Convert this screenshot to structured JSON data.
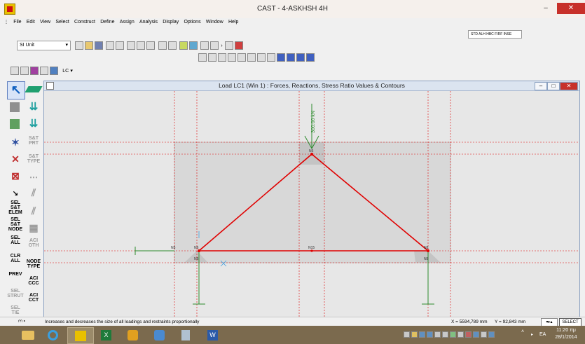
{
  "window": {
    "title": "CAST - 4-ASKHSH 4H",
    "minimize": "–",
    "maximize": "□",
    "close": "✕"
  },
  "menu": [
    "File",
    "Edit",
    "View",
    "Select",
    "Construct",
    "Define",
    "Assign",
    "Analysis",
    "Display",
    "Options",
    "Window",
    "Help"
  ],
  "toolbar": {
    "unit": "SI Unit",
    "right_dropdown": "STD  ALH  HBC  FIRF  INSE",
    "lc_label": "LC"
  },
  "palette": {
    "st_prt": "S&T PRT",
    "st_type": "S&T TYPE",
    "sel_elem": "SEL S&T ELEM",
    "sel_node": "SEL S&T NODE",
    "sel_all": "SEL ALL",
    "aci_oth": "ACI OTH",
    "clr_all": "CLR ALL",
    "node_type": "NODE TYPE",
    "prev": "PREV",
    "aci_ccc": "ACI CCC",
    "sel_strut": "SEL STRUT",
    "aci_cct": "ACI CCT",
    "sel_tie": "SEL TIE"
  },
  "child": {
    "title": "Load LC1 (Win 1) : Forces, Reactions, Stress Ratio Values & Contours",
    "minimize": "–",
    "restore": "□",
    "close": "✕"
  },
  "drawing": {
    "load_label": "300.00 kN",
    "nodes": {
      "top": "N6",
      "left": "N6",
      "right": "N8",
      "mid": "N15",
      "far_left": "N5",
      "left_low": "N6",
      "right_low": "N8"
    }
  },
  "status": {
    "message": "Increases and decreases the size of all loadings and restraints proportionally",
    "x_coord": "X = 5594,789 mm",
    "y_coord": "Y = 92,843 mm",
    "select": "SELECT"
  },
  "taskbar": {
    "lang": "EA",
    "time": "11:20 πμ",
    "date": "28/1/2014"
  },
  "colors": {
    "truss": "#e00000",
    "support": "#2e8b2e",
    "load": "#2e8b2e",
    "guides": "#e00000",
    "taskbar": "#7b6a4e"
  }
}
